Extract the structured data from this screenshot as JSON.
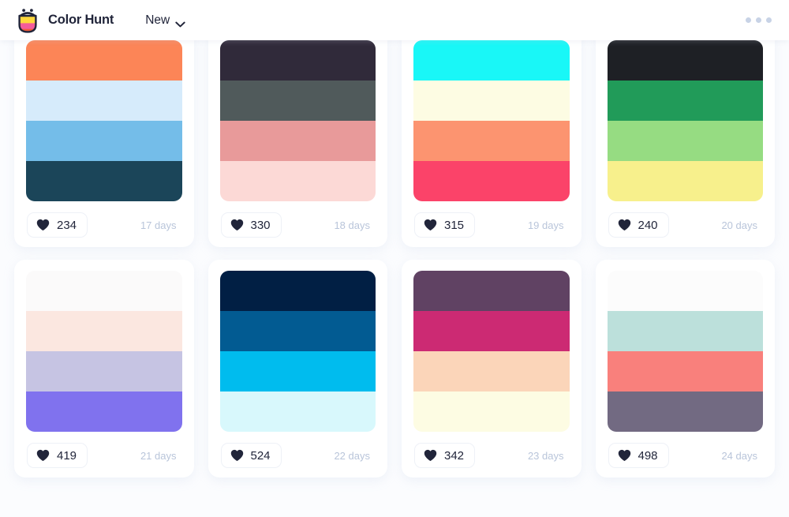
{
  "header": {
    "brand_name": "Color Hunt",
    "logo_icon": "color-hunt-smiley-logo",
    "nav": {
      "label": "New",
      "chevron_icon": "chevron-down-icon"
    },
    "menu_icon": "more-options-dots-icon"
  },
  "palettes": [
    {
      "colors": [
        "#FC8557",
        "#D6EBFB",
        "#74BDE9",
        "#1B4559"
      ],
      "likes": "234",
      "age": "17 days",
      "heart_icon": "heart-icon"
    },
    {
      "colors": [
        "#302A3A",
        "#505A5B",
        "#E89A9A",
        "#FCD9D6"
      ],
      "likes": "330",
      "age": "18 days",
      "heart_icon": "heart-icon"
    },
    {
      "colors": [
        "#19F7F7",
        "#FDFCE3",
        "#FC9470",
        "#FB4369"
      ],
      "likes": "315",
      "age": "19 days",
      "heart_icon": "heart-icon"
    },
    {
      "colors": [
        "#1E2025",
        "#219B59",
        "#96DC82",
        "#F7F08C"
      ],
      "likes": "240",
      "age": "20 days",
      "heart_icon": "heart-icon"
    },
    {
      "colors": [
        "#FBFAFA",
        "#FBE7E0",
        "#C6C4E3",
        "#8072EE"
      ],
      "likes": "419",
      "age": "21 days",
      "heart_icon": "heart-icon"
    },
    {
      "colors": [
        "#011F44",
        "#025B92",
        "#00BCEE",
        "#D8F8FC"
      ],
      "likes": "524",
      "age": "22 days",
      "heart_icon": "heart-icon"
    },
    {
      "colors": [
        "#604263",
        "#CC2A73",
        "#FBD5B9",
        "#FDFCE3"
      ],
      "likes": "342",
      "age": "23 days",
      "heart_icon": "heart-icon"
    },
    {
      "colors": [
        "#FCFCFC",
        "#BCE0DB",
        "#F9807C",
        "#726A82"
      ],
      "likes": "498",
      "age": "24 days",
      "heart_icon": "heart-icon"
    }
  ],
  "colors": {
    "page_background": "#fbfcfe",
    "card_background": "#ffffff",
    "text_dark": "#21253a",
    "text_muted": "#b9c5da"
  }
}
